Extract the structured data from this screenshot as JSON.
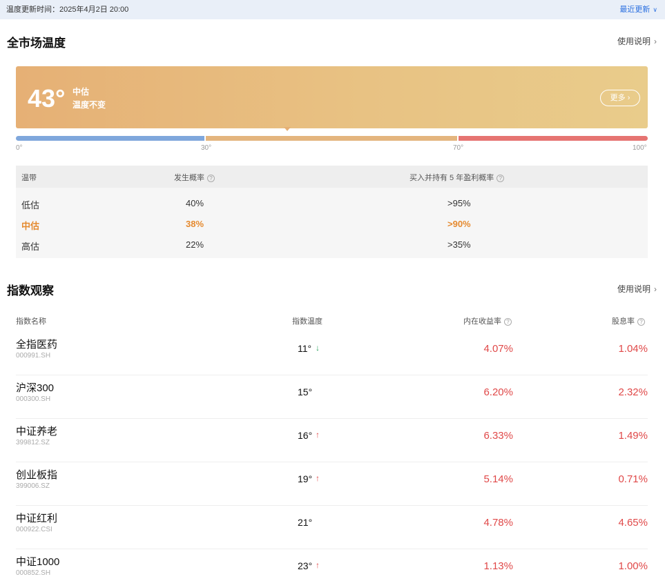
{
  "topbar": {
    "update_time": "温度更新时间：2025年4月2日 20:00",
    "latest_label": "最近更新",
    "chevron": "∨"
  },
  "market": {
    "title": "全市场温度",
    "help": "使用说明",
    "temperature": "43°",
    "band": "中估",
    "change": "温度不变",
    "more": "更多",
    "scale_ticks": [
      "0°",
      "30°",
      "70°",
      "100°"
    ],
    "temperature_value": 43,
    "table": {
      "headers": [
        "温带",
        "发生概率",
        "买入并持有 5 年盈利概率"
      ],
      "rows": [
        {
          "band": "低估",
          "prob": "40%",
          "profit": ">95%"
        },
        {
          "band": "中估",
          "prob": "38%",
          "profit": ">90%"
        },
        {
          "band": "高估",
          "prob": "22%",
          "profit": ">35%"
        }
      ]
    }
  },
  "index": {
    "title": "指数观察",
    "help": "使用说明",
    "headers": [
      "指数名称",
      "指数温度",
      "内在收益率",
      "股息率"
    ],
    "rows": [
      {
        "name": "全指医药",
        "code": "000991.SH",
        "temp": "11°",
        "trend": "down",
        "yield": "4.07%",
        "div": "1.04%"
      },
      {
        "name": "沪深300",
        "code": "000300.SH",
        "temp": "15°",
        "trend": "none",
        "yield": "6.20%",
        "div": "2.32%"
      },
      {
        "name": "中证养老",
        "code": "399812.SZ",
        "temp": "16°",
        "trend": "up",
        "yield": "6.33%",
        "div": "1.49%"
      },
      {
        "name": "创业板指",
        "code": "399006.SZ",
        "temp": "19°",
        "trend": "up",
        "yield": "5.14%",
        "div": "0.71%"
      },
      {
        "name": "中证红利",
        "code": "000922.CSI",
        "temp": "21°",
        "trend": "none",
        "yield": "4.78%",
        "div": "4.65%"
      },
      {
        "name": "中证1000",
        "code": "000852.SH",
        "temp": "23°",
        "trend": "up",
        "yield": "1.13%",
        "div": "1.00%"
      }
    ]
  },
  "colors": {
    "low": "#7fa7dc",
    "mid": "#e4b57e",
    "high": "#e67472",
    "accent_orange": "#e58a2f",
    "value_red": "#e04848"
  }
}
